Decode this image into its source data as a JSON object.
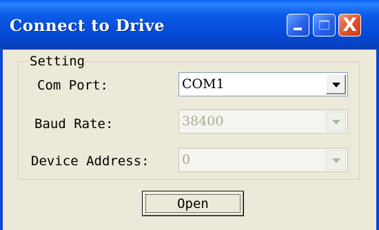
{
  "window": {
    "title": "Connect to Drive",
    "controls": [
      "minimize-icon",
      "maximize-icon",
      "close-icon"
    ],
    "close_glyph": "X"
  },
  "group": {
    "title": "Setting",
    "fields": [
      {
        "label": "Com Port:",
        "value": "COM1",
        "enabled": true
      },
      {
        "label": "Baud Rate:",
        "value": "38400",
        "enabled": false
      },
      {
        "label": "Device Address:",
        "value": "0",
        "enabled": false
      }
    ]
  },
  "actions": {
    "open_label": "Open"
  },
  "colors": {
    "titlebar": "#0449d4",
    "dialog_bg": "#ece9d8",
    "close_button": "#e1512a"
  }
}
